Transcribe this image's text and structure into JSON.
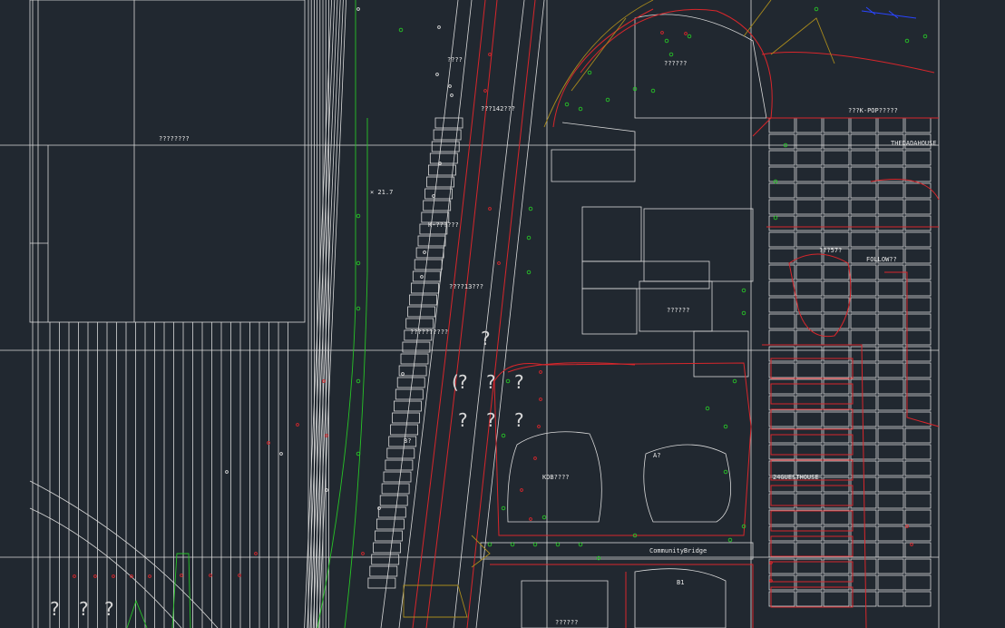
{
  "viewport": {
    "background": "#212830",
    "colors": {
      "line_white": "#d9d9d9",
      "line_red": "#d8262b",
      "line_green": "#27c427",
      "line_yellow": "#a88a1c",
      "line_blue": "#2a45ff"
    }
  },
  "labels": {
    "site_top": "??????",
    "gymnasium": "????????",
    "pop_street": "???K-POP?????",
    "num_142": "???142???",
    "dadahouse": "THEDADAHOUSE",
    "k_label": "K-??????",
    "follow": "FOLLOW??",
    "guesthouse": "24GUESTHOUSE",
    "kdb": "KDB????",
    "bridge": "CommunityBridge",
    "a_marker": "A?",
    "b1_marker": "B1",
    "b_marker": "B?",
    "road_a": "????13???",
    "road_b": "???57?",
    "road_c": "??????????",
    "alley_1": "????",
    "alley_2": "??????",
    "marker_717": "× 21.7"
  }
}
